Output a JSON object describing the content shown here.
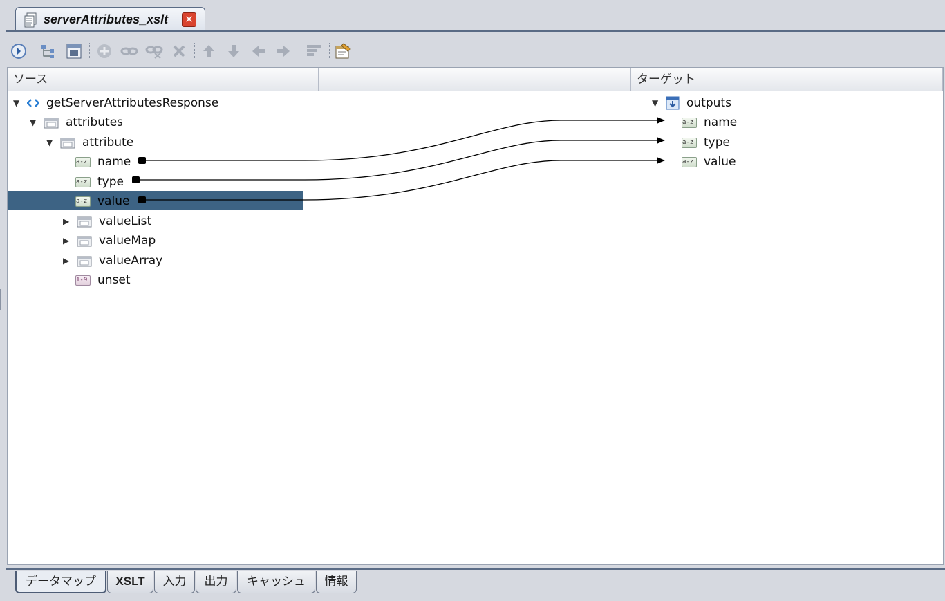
{
  "editor": {
    "tab_title": "serverAttributes_xslt",
    "close_label": "✕"
  },
  "toolbar": {
    "buttons": [
      {
        "name": "run-icon",
        "enabled": true
      },
      {
        "name": "tree-layout-icon",
        "enabled": true
      },
      {
        "name": "function-panel-icon",
        "enabled": true
      },
      {
        "name": "add-icon",
        "enabled": false
      },
      {
        "name": "link-icon",
        "enabled": false
      },
      {
        "name": "unlink-icon",
        "enabled": false
      },
      {
        "name": "delete-icon",
        "enabled": false
      },
      {
        "name": "move-up-icon",
        "enabled": false
      },
      {
        "name": "move-down-icon",
        "enabled": false
      },
      {
        "name": "move-left-icon",
        "enabled": false
      },
      {
        "name": "move-right-icon",
        "enabled": false
      },
      {
        "name": "align-icon",
        "enabled": false
      },
      {
        "name": "properties-icon",
        "enabled": true
      }
    ]
  },
  "mapper": {
    "source_header": "ソース",
    "target_header": "ターゲット",
    "source_tree": {
      "root": "getServerAttributesResponse",
      "attributes": "attributes",
      "attribute": "attribute",
      "fields": [
        "name",
        "type",
        "value"
      ],
      "collapsed": [
        "valueList",
        "valueMap",
        "valueArray"
      ],
      "unset": "unset"
    },
    "target_tree": {
      "root": "outputs",
      "fields": [
        "name",
        "type",
        "value"
      ]
    },
    "selected": "value",
    "mappings": [
      {
        "from": "name",
        "to": "name"
      },
      {
        "from": "type",
        "to": "type"
      },
      {
        "from": "value",
        "to": "value"
      }
    ],
    "type_badges": {
      "string": "a-z",
      "number": "1-9"
    }
  },
  "bottom_tabs": [
    "データマップ",
    "XSLT",
    "入力",
    "出力",
    "キャッシュ",
    "情報"
  ],
  "active_bottom_tab": "データマップ",
  "colors": {
    "selection": "#3d6384",
    "accent": "#5a6b85",
    "close": "#d9442f"
  }
}
